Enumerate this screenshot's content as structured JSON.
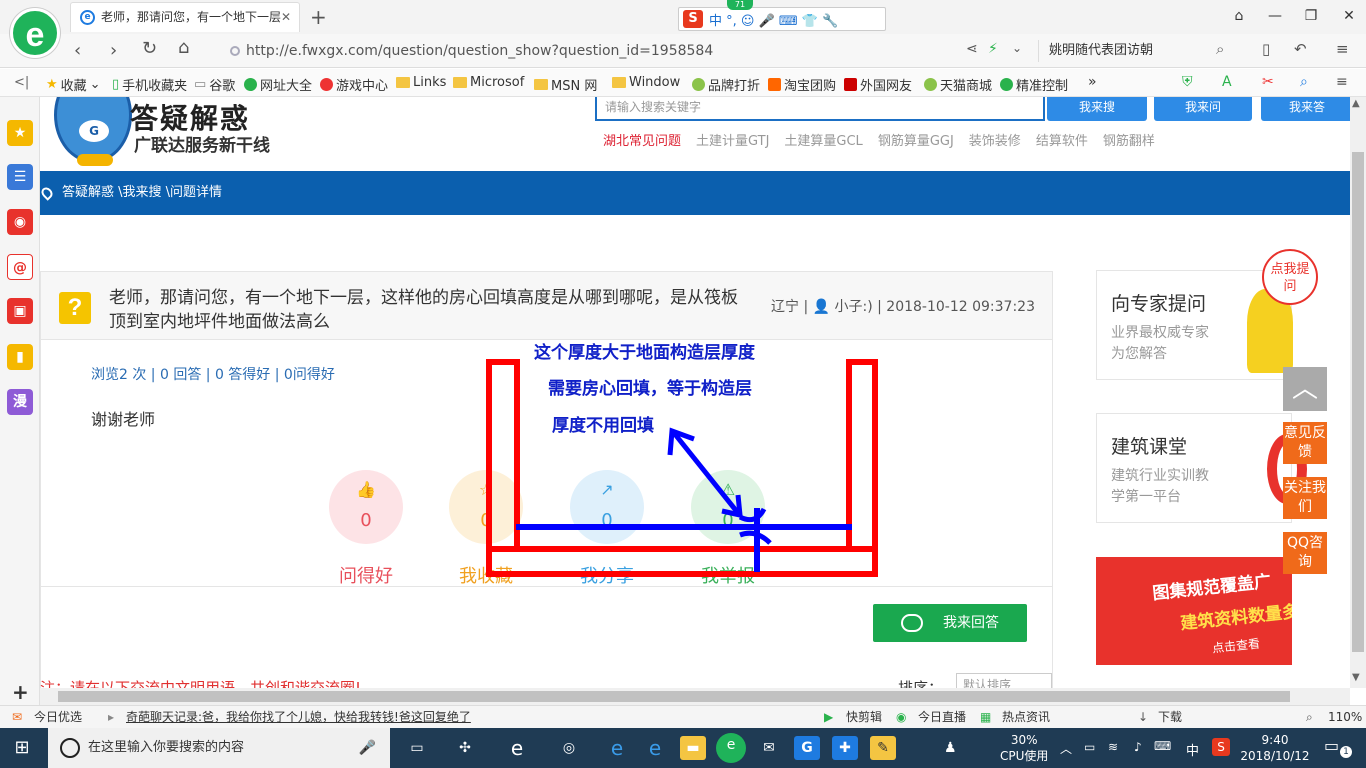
{
  "browser": {
    "tab_title": "老师，那请问您，有一个地下一层",
    "tab_close": "✕",
    "new_tab": "+",
    "ime_label": "中 °, ☺ 🎤 ⌨ 👕 🔧",
    "ime_badge": "71",
    "url": "http://e.fwxgx.com/question/question_show?question_id=1958584",
    "search_text": "姚明随代表团访朝",
    "window_buttons": [
      "⌄",
      "—",
      "❐",
      "✕"
    ]
  },
  "bookmarks": [
    "收藏",
    "手机收藏夹",
    "谷歌",
    "网址大全",
    "游戏中心",
    "Links",
    "Microsof",
    "MSN 网",
    "Window",
    "品牌打折",
    "淘宝团购",
    "外国网友",
    "天猫商城",
    "精准控制"
  ],
  "bookmarks_more": "»",
  "page": {
    "brand_title": "答疑解惑",
    "brand_subtitle": "广联达服务新干线",
    "search_placeholder": "请输入搜索关键字",
    "btn_search": "我来搜",
    "btn_ask": "我来问",
    "btn_answer_top": "我来答",
    "categories": [
      "湖北常见问题",
      "土建计量GTJ",
      "土建算量GCL",
      "钢筋算量GGJ",
      "装饰装修",
      "结算软件",
      "钢筋翻样"
    ],
    "breadcrumb": "答疑解惑 \\我来搜 \\问题详情",
    "question": {
      "title": "老师，那请问您，有一个地下一层，这样他的房心回填高度是从哪到哪呢，是从筏板顶到室内地坪件地面做法高么",
      "meta": "辽宁 | 👤 小子:) | 2018-10-12 09:37:23",
      "stats": "浏览2 次 | 0 回答 | 0 答得好 | 0问得好",
      "body": "谢谢老师"
    },
    "actions": [
      {
        "icon": "👍",
        "count": "0",
        "label": "问得好",
        "color": "#e8505b"
      },
      {
        "icon": "☆",
        "count": "0",
        "label": "我收藏",
        "color": "#f0a020"
      },
      {
        "icon": "↗",
        "count": "0",
        "label": "我分享",
        "color": "#3aa0e0"
      },
      {
        "icon": "⚠",
        "count": "0",
        "label": "我举报",
        "color": "#3ab05a"
      }
    ],
    "answer_button": "我来回答",
    "notice": "注：请在以下交流中文明用语，共创和谐交流圈!",
    "sort_label": "排序：",
    "sort_value": "默认排序",
    "right": {
      "expert_title": "向专家提问",
      "expert_sub1": "业界最权威专家",
      "expert_sub2": "为您解答",
      "click_badge": "点我提问",
      "class_title": "建筑课堂",
      "class_sub1": "建筑行业实训教",
      "class_sub2": "学第一平台",
      "banner_line1": "图集规范覆盖广",
      "banner_line2": "建筑资料数量多",
      "banner_line3": "点击查看",
      "float_feedback": "意见反馈",
      "float_follow": "关注我们",
      "float_qq": "QQ咨询",
      "to_top": "︿"
    }
  },
  "annotation": {
    "line1": "这个厚度大于地面构造层厚度",
    "line2": "需要房心回填，等于构造层",
    "line3": "厚度不用回填",
    "frame_color": "#ff0000",
    "arrow_color": "#0000ff"
  },
  "statusbar": {
    "left1": "今日优选",
    "news": "奇葩聊天记录:爸，我给你找了个儿媳，快给我转钱!爸这回复绝了",
    "quick_cut": "快剪辑",
    "live": "今日直播",
    "hot": "热点资讯",
    "download": "下载",
    "zoom": "110%"
  },
  "taskbar": {
    "search_placeholder": "在这里输入你要搜索的内容",
    "cpu_pct": "30%",
    "cpu_label": "CPU使用",
    "ime": "中",
    "time": "9:40",
    "date": "2018/10/12",
    "notif_count": "1"
  }
}
